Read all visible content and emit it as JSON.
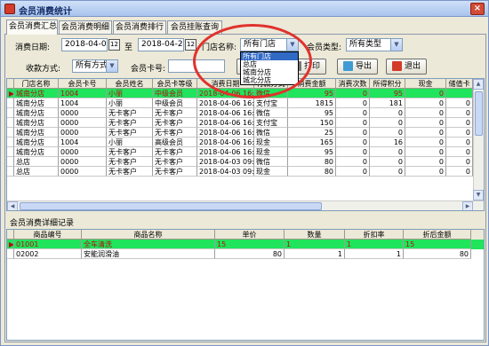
{
  "window": {
    "title": "会员消费统计"
  },
  "tabs": [
    "会员消费汇总",
    "会员消费明细",
    "会员消费排行",
    "会员挂账查询"
  ],
  "filters": {
    "date_label": "消费日期:",
    "date_from": "2018-04-01",
    "to_label": "至",
    "date_to": "2018-04-20",
    "cal_icon": "12",
    "store_label": "门店名称:",
    "store_value": "所有门店",
    "member_type_label": "会员类型:",
    "member_type_value": "所有类型",
    "pay_label": "收款方式:",
    "pay_value": "所有方式",
    "card_label": "会员卡号:",
    "card_value": ""
  },
  "store_dropdown": [
    "所有门店",
    "总店",
    "城南分店",
    "城北分店"
  ],
  "buttons": {
    "query": "查询",
    "print": "打印",
    "export": "导出",
    "exit": "退出"
  },
  "summary_table": {
    "columns": [
      "门店名称",
      "会员卡号",
      "会员姓名",
      "会员卡等级",
      "消费日期",
      "付款方式",
      "消费金额",
      "消费次数",
      "所得积分",
      "现金",
      "储值卡"
    ],
    "rows": [
      [
        "城南分店",
        "1004",
        "小丽",
        "中级会员",
        "2018-04-06 16:27",
        "微信",
        "95",
        "0",
        "95",
        "0",
        ""
      ],
      [
        "城南分店",
        "1004",
        "小丽",
        "中级会员",
        "2018-04-06 16:28",
        "支付宝",
        "1815",
        "0",
        "181",
        "0",
        "0"
      ],
      [
        "城南分店",
        "0000",
        "无卡客户",
        "无卡客户",
        "2018-04-06 16:28",
        "微信",
        "95",
        "0",
        "0",
        "0",
        "0"
      ],
      [
        "城南分店",
        "0000",
        "无卡客户",
        "无卡客户",
        "2018-04-06 16:28",
        "支付宝",
        "150",
        "0",
        "0",
        "0",
        "0"
      ],
      [
        "城南分店",
        "0000",
        "无卡客户",
        "无卡客户",
        "2018-04-06 16:29",
        "微信",
        "25",
        "0",
        "0",
        "0",
        "0"
      ],
      [
        "城南分店",
        "1004",
        "小丽",
        "高级会员",
        "2018-04-06 16:33",
        "现金",
        "165",
        "0",
        "16",
        "0",
        "0"
      ],
      [
        "城南分店",
        "0000",
        "无卡客户",
        "无卡客户",
        "2018-04-06 16:33",
        "现金",
        "95",
        "0",
        "0",
        "0",
        "0"
      ],
      [
        "总店",
        "0000",
        "无卡客户",
        "无卡客户",
        "2018-04-03 09:44",
        "微信",
        "80",
        "0",
        "0",
        "0",
        "0"
      ],
      [
        "总店",
        "0000",
        "无卡客户",
        "无卡客户",
        "2018-04-03 09:44",
        "现金",
        "80",
        "0",
        "0",
        "0",
        "0"
      ]
    ]
  },
  "detail_section_label": "会员消费详细记录",
  "detail_table": {
    "columns": [
      "商品编号",
      "商品名称",
      "单价",
      "数量",
      "折扣率",
      "折后金额"
    ],
    "rows": [
      [
        "01001",
        "全车清洗",
        "15",
        "1",
        "1",
        "15"
      ],
      [
        "02002",
        "安能润滑油",
        "80",
        "1",
        "1",
        "80"
      ]
    ]
  },
  "colors": {
    "highlight_row": "#1fe45c",
    "highlight_text": "#b21010",
    "annotation": "#e0322d"
  }
}
